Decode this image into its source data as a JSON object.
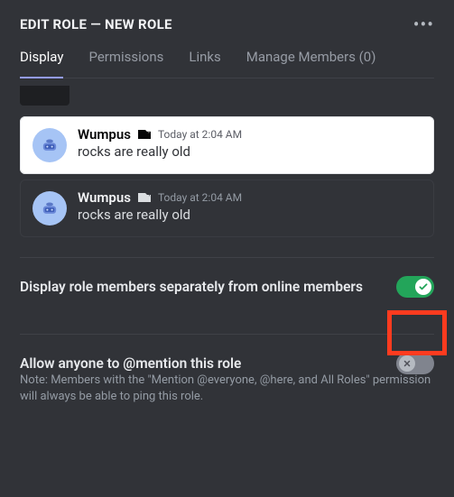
{
  "header": {
    "title": "EDIT ROLE — NEW ROLE"
  },
  "tabs": {
    "display": "Display",
    "permissions": "Permissions",
    "links": "Links",
    "manage": "Manage Members (0)"
  },
  "preview": {
    "username": "Wumpus",
    "timestamp": "Today at 2:04 AM",
    "message": "rocks are really old"
  },
  "settings": {
    "hoist": {
      "label": "Display role members separately from online members"
    },
    "mention": {
      "label": "Allow anyone to @mention this role",
      "note": "Note: Members with the \"Mention @everyone, @here, and All Roles\" permission will always be able to ping this role."
    }
  }
}
